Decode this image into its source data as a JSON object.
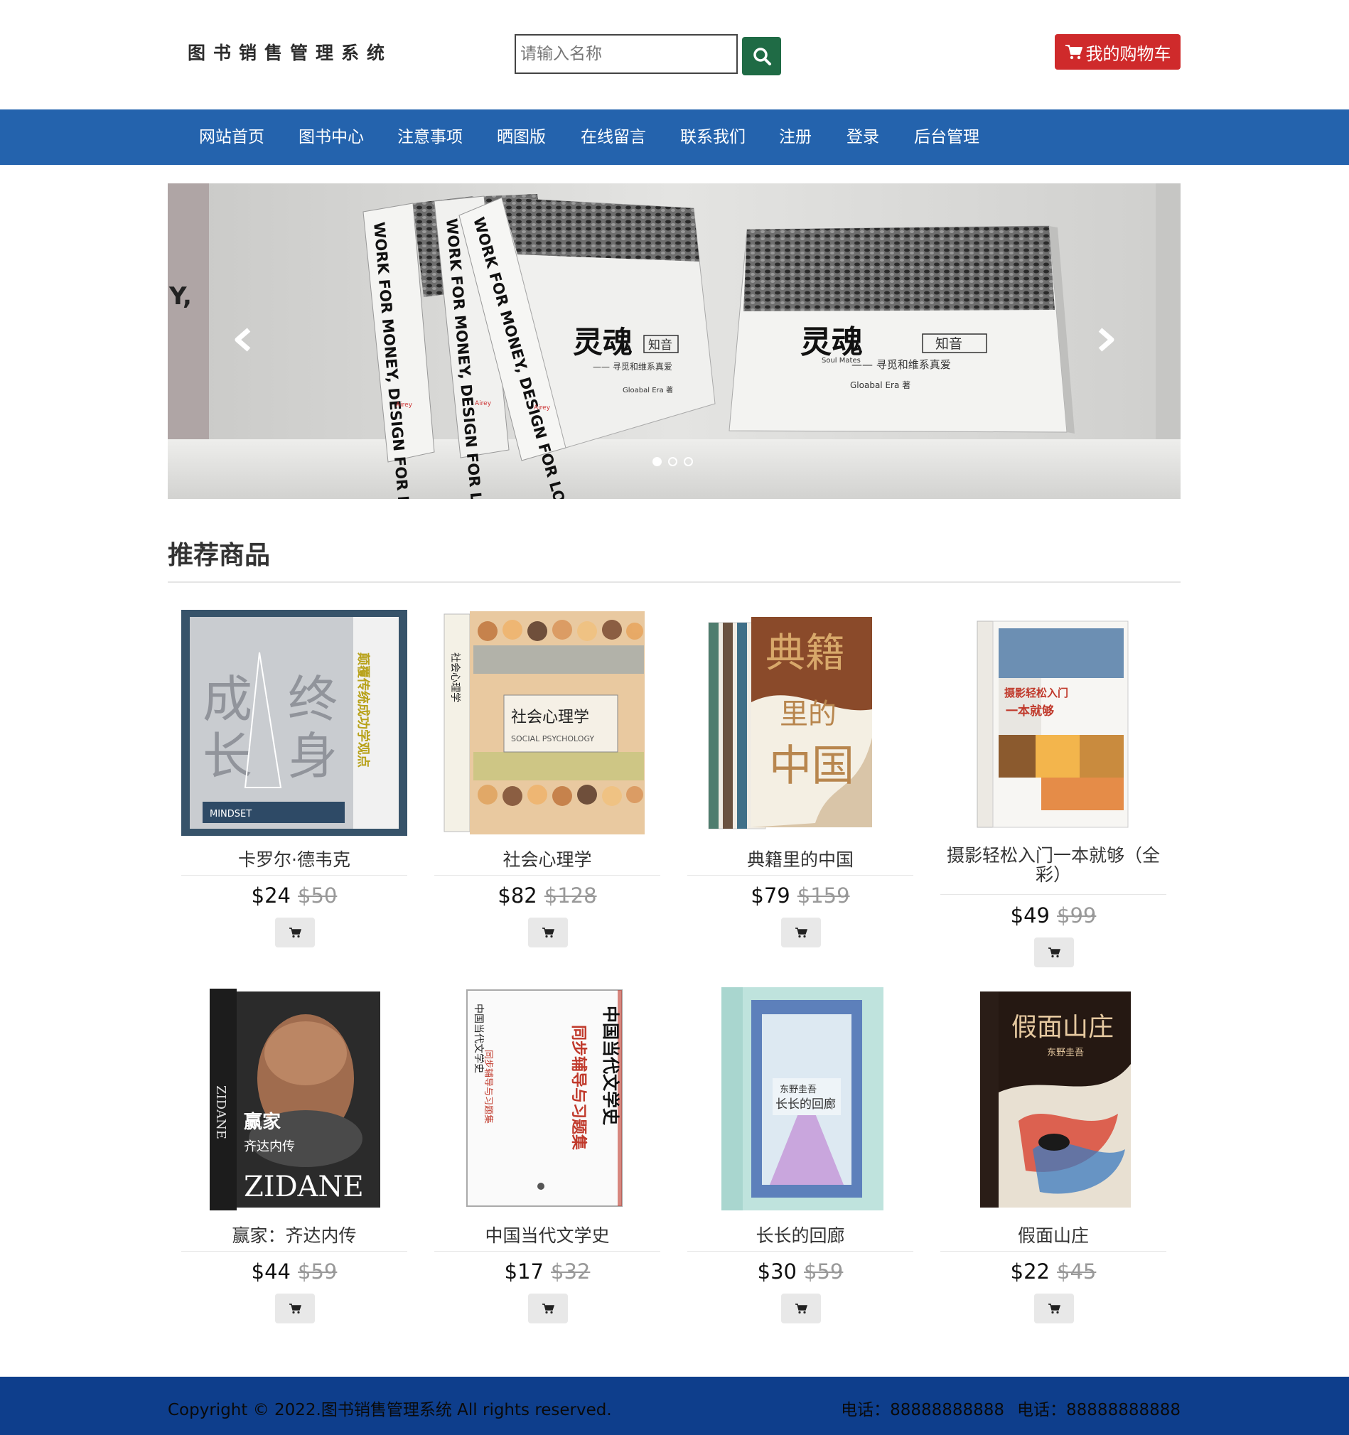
{
  "header": {
    "logo_text": "图书销售管理系统",
    "search_placeholder": "请输入名称",
    "cart_label": "我的购物车"
  },
  "nav": {
    "items": [
      {
        "label": "网站首页"
      },
      {
        "label": "图书中心"
      },
      {
        "label": "注意事项"
      },
      {
        "label": "晒图版"
      },
      {
        "label": "在线留言"
      },
      {
        "label": "联系我们"
      },
      {
        "label": "注册"
      },
      {
        "label": "登录"
      },
      {
        "label": "后台管理"
      }
    ]
  },
  "carousel": {
    "active_index": 0,
    "slide_count": 3,
    "spine_text": "WORK FOR MONEY, DESIGN FOR LOVE",
    "publisher": "Airey",
    "book_title": "灵魂",
    "book_tag": "知音",
    "book_en": "Soul Mates",
    "book_sub": "—— 寻觅和维系真爱",
    "book_author": "Gloabal Era 著"
  },
  "section": {
    "title": "推荐商品"
  },
  "products": [
    {
      "name": "卡罗尔·德韦克",
      "price": "$24",
      "old_price": "$50",
      "cover_text": "终身成长"
    },
    {
      "name": "社会心理学",
      "price": "$82",
      "old_price": "$128",
      "cover_text": "社会心理学"
    },
    {
      "name": "典籍里的中国",
      "price": "$79",
      "old_price": "$159",
      "cover_text": "典籍里的中国"
    },
    {
      "name": "摄影轻松入门一本就够（全彩）",
      "price": "$49",
      "old_price": "$99",
      "cover_text": "摄影轻松入门一本就够"
    },
    {
      "name": "赢家：齐达内传",
      "price": "$44",
      "old_price": "$59",
      "cover_text": "ZIDANE"
    },
    {
      "name": "中国当代文学史",
      "price": "$17",
      "old_price": "$32",
      "cover_text": "中国当代文学史"
    },
    {
      "name": "长长的回廊",
      "price": "$30",
      "old_price": "$59",
      "cover_text": "长长的回廊"
    },
    {
      "name": "假面山庄",
      "price": "$22",
      "old_price": "$45",
      "cover_text": "假面山庄"
    }
  ],
  "footer": {
    "copyright": "Copyright © 2022.图书销售管理系统 All rights reserved.",
    "phone1": "电话：88888888888",
    "phone2": "电话：88888888888"
  },
  "colors": {
    "nav_bg": "#2463ad",
    "footer_bg": "#0e3e8c",
    "cart_red": "#cf2a2b",
    "search_green": "#1f6b45"
  },
  "icons": {
    "search": "search-icon",
    "cart": "cart-icon",
    "prev": "chevron-left-icon",
    "next": "chevron-right-icon",
    "add": "add-to-cart-icon"
  }
}
